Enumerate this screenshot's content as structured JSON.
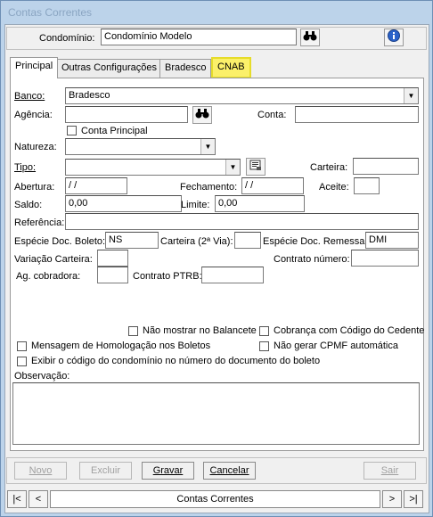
{
  "window": {
    "title": "Contas Correntes"
  },
  "header": {
    "condominio_label": "Condomínio:",
    "condominio_value": "Condomínio Modelo",
    "search_icon": "binoculars-icon",
    "info_icon": "info-icon"
  },
  "tabs": [
    {
      "label": "Principal"
    },
    {
      "label": "Outras Configurações"
    },
    {
      "label": "Bradesco"
    },
    {
      "label": "CNAB"
    }
  ],
  "form": {
    "banco_label": "Banco:",
    "banco_value": "Bradesco",
    "agencia_label": "Agência:",
    "agencia_value": "",
    "conta_label": "Conta:",
    "conta_value": "",
    "conta_principal_label": "Conta Principal",
    "natureza_label": "Natureza:",
    "natureza_value": "",
    "tipo_label": "Tipo:",
    "tipo_value": "",
    "carteira_label": "Carteira:",
    "carteira_value": "",
    "abertura_label": "Abertura:",
    "abertura_value": " / /",
    "fechamento_label": "Fechamento:",
    "fechamento_value": " / /",
    "aceite_label": "Aceite:",
    "aceite_value": "",
    "saldo_label": "Saldo:",
    "saldo_value": "0,00",
    "limite_label": "Limite:",
    "limite_value": "0,00",
    "referencia_label": "Referência:",
    "referencia_value": "",
    "especie_boleto_label": "Espécie Doc. Boleto:",
    "especie_boleto_value": "NS",
    "carteira2_label": "Carteira (2ª Via):",
    "carteira2_value": "",
    "especie_remessa_label": "Espécie Doc. Remessa:",
    "especie_remessa_value": "DMI",
    "variacao_label": "Variação Carteira:",
    "variacao_value": "",
    "contrato_numero_label": "Contrato número:",
    "contrato_numero_value": "",
    "ag_cobradora_label": "Ag. cobradora:",
    "ag_cobradora_value": "",
    "contrato_ptrb_label": "Contrato PTRB:",
    "contrato_ptrb_value": "",
    "nao_mostrar_balancete": "Não mostrar no Balancete",
    "cobranca_codigo_cedente": "Cobrança com Código do Cedente",
    "mensagem_homologacao": "Mensagem de Homologação nos Boletos",
    "nao_gerar_cpmf": "Não gerar CPMF automática",
    "exibir_codigo": "Exibir o código do condomínio no número do documento do boleto",
    "observacao_label": "Observação:",
    "observacao_value": ""
  },
  "buttons": {
    "novo": "Novo",
    "excluir": "Excluir",
    "gravar": "Gravar",
    "cancelar": "Cancelar",
    "sair": "Sair"
  },
  "navigator": {
    "first": "|<",
    "prev": "<",
    "caption": "Contas Correntes",
    "next": ">",
    "last": ">|"
  }
}
